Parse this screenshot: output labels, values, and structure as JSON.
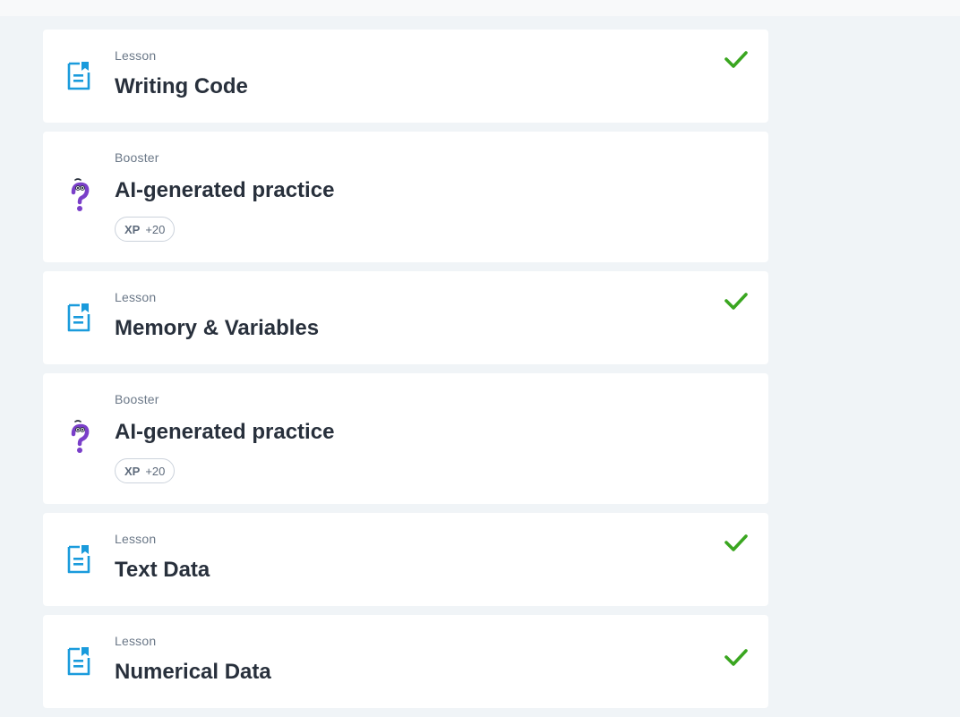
{
  "colors": {
    "background": "#f0f4f7",
    "card": "#ffffff",
    "lesson_icon": "#1a9bdc",
    "booster_icon": "#7a3fc9",
    "check": "#3aa620",
    "title_text": "#28303c",
    "kind_text": "#6b7888"
  },
  "items": [
    {
      "kind": "Lesson",
      "title": "Writing Code",
      "icon": "lesson-document-icon",
      "completed": true
    },
    {
      "kind": "Booster",
      "title": "AI-generated practice",
      "icon": "question-mark-character-icon",
      "xp_label": "XP",
      "xp_value": "+20",
      "completed": false
    },
    {
      "kind": "Lesson",
      "title": "Memory & Variables",
      "icon": "lesson-document-icon",
      "completed": true
    },
    {
      "kind": "Booster",
      "title": "AI-generated practice",
      "icon": "question-mark-character-icon",
      "xp_label": "XP",
      "xp_value": "+20",
      "completed": false
    },
    {
      "kind": "Lesson",
      "title": "Text Data",
      "icon": "lesson-document-icon",
      "completed": true
    },
    {
      "kind": "Lesson",
      "title": "Numerical Data",
      "icon": "lesson-document-icon",
      "completed": true
    }
  ]
}
